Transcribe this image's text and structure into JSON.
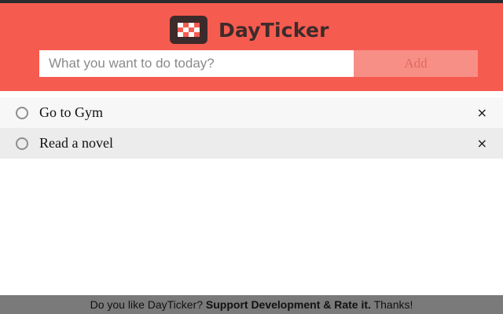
{
  "app": {
    "name": "DayTicker",
    "logo_icon": "dayticker-logo-icon"
  },
  "input": {
    "placeholder": "What you want to do today?",
    "value": ""
  },
  "add_button": {
    "label": "Add"
  },
  "todos": [
    {
      "label": "Go to Gym",
      "done": false,
      "delete_label": "×"
    },
    {
      "label": "Read a novel",
      "done": false,
      "delete_label": "×"
    }
  ],
  "footer": {
    "prefix": "Do you like DayTicker?",
    "link": "Support Development & Rate it.",
    "suffix": "Thanks!"
  },
  "colors": {
    "header_bg": "#f65b4f",
    "add_button_bg": "#f88f86",
    "footer_bg": "#7a7a7a",
    "brand_text": "#3d2b2b"
  }
}
